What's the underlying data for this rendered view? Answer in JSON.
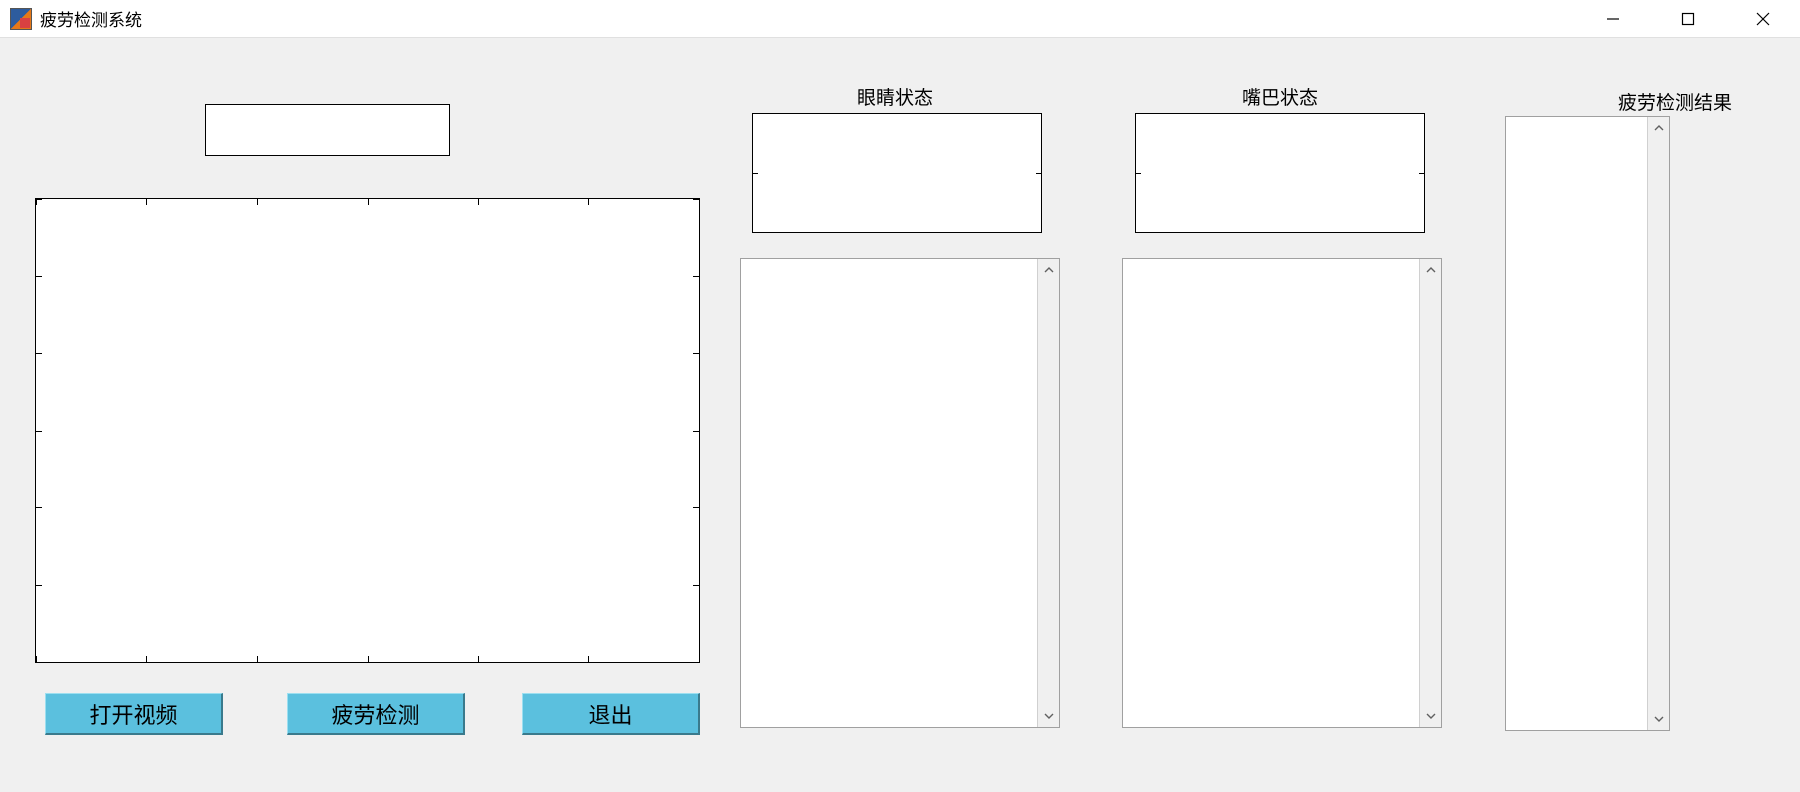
{
  "window": {
    "title": "疲劳检测系统"
  },
  "labels": {
    "eye_state": "眼睛状态",
    "mouth_state": "嘴巴状态",
    "fatigue_result": "疲劳检测结果"
  },
  "buttons": {
    "open_video": "打开视频",
    "detect_fatigue": "疲劳检测",
    "exit": "退出"
  },
  "inputs": {
    "video_path": ""
  },
  "listboxes": {
    "eye_log": [],
    "mouth_log": [],
    "result_log": []
  },
  "colors": {
    "button_bg": "#5bc0de",
    "client_bg": "#f0f0f0"
  }
}
